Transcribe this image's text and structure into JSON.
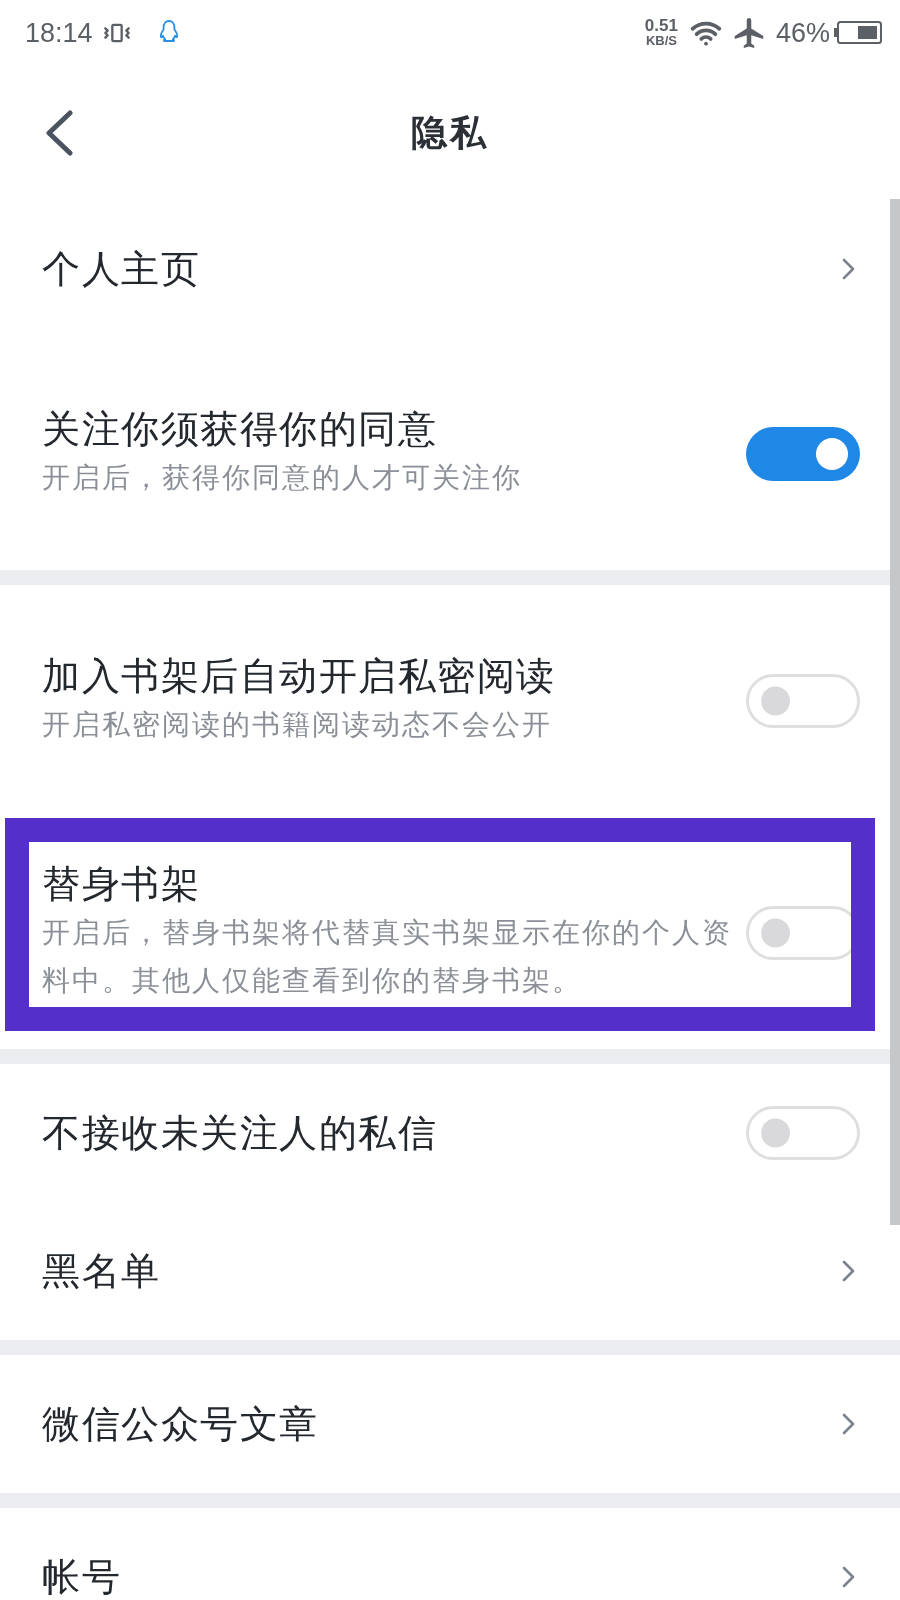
{
  "status_bar": {
    "time": "18:14",
    "speed_value": "0.51",
    "speed_unit": "KB/S",
    "battery": "46%"
  },
  "header": {
    "title": "隐私"
  },
  "groups": [
    {
      "items": [
        {
          "kind": "link",
          "title": "个人主页",
          "highlighted": false
        },
        {
          "kind": "toggle",
          "title": "关注你须获得你的同意",
          "subtitle": "开启后，获得你同意的人才可关注你",
          "on": true,
          "highlighted": false
        }
      ]
    },
    {
      "items": [
        {
          "kind": "toggle",
          "title": "加入书架后自动开启私密阅读",
          "subtitle": "开启私密阅读的书籍阅读动态不会公开",
          "on": false,
          "highlighted": false
        },
        {
          "kind": "toggle",
          "title": "替身书架",
          "subtitle": "开启后，替身书架将代替真实书架显示在你的个人资料中。其他人仅能查看到你的替身书架。",
          "on": false,
          "highlighted": true
        }
      ]
    },
    {
      "items": [
        {
          "kind": "toggle",
          "title": "不接收未关注人的私信",
          "on": false,
          "highlighted": false
        },
        {
          "kind": "link",
          "title": "黑名单",
          "highlighted": false
        }
      ]
    },
    {
      "items": [
        {
          "kind": "link",
          "title": "微信公众号文章",
          "highlighted": false
        }
      ]
    },
    {
      "items": [
        {
          "kind": "link",
          "title": "帐号",
          "highlighted": false
        }
      ]
    }
  ]
}
